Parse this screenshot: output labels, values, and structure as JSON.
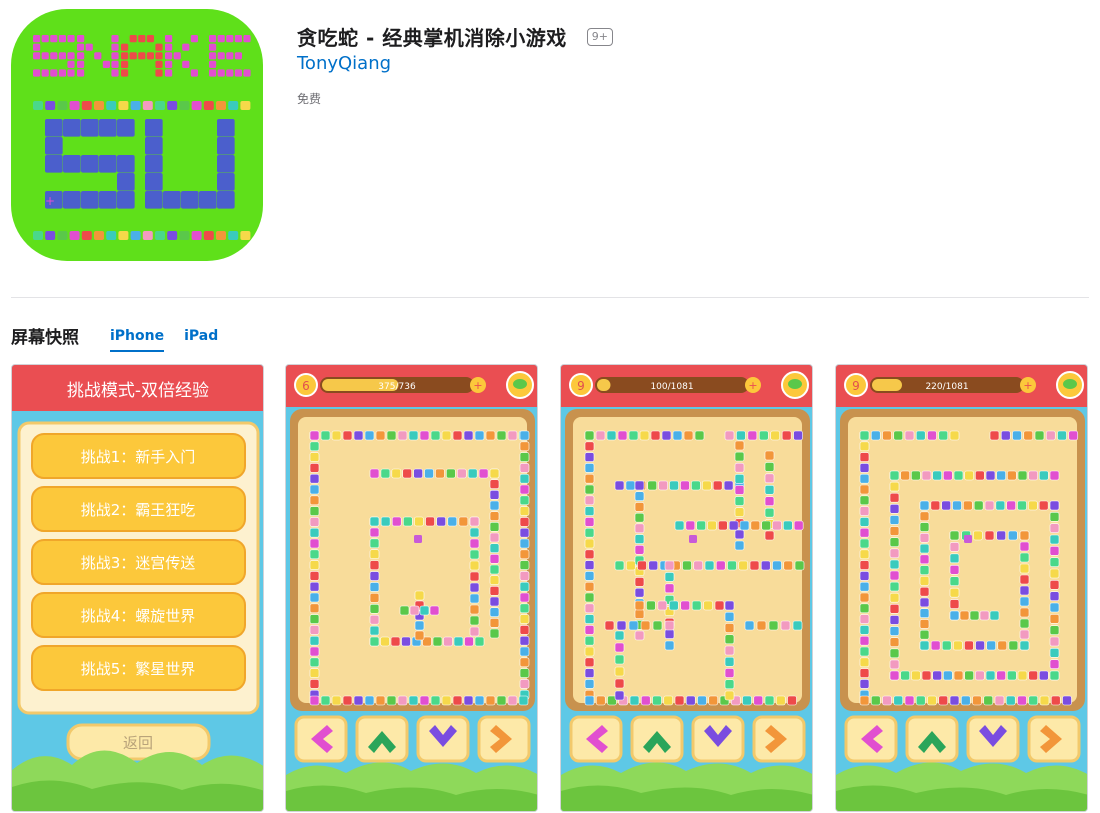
{
  "app": {
    "title": "贪吃蛇 - 经典掌机消除小游戏",
    "age_rating": "9+",
    "developer": "TonyQiang",
    "price": "免费",
    "icon": {
      "top_word": "SNAKE",
      "bottom_word": "SU",
      "background_color": "#5fe01a"
    }
  },
  "screenshots": {
    "section_title": "屏幕快照",
    "tabs": [
      {
        "label": "iPhone",
        "active": true
      },
      {
        "label": "iPad",
        "active": false
      }
    ],
    "menu_screen": {
      "header": "挑战模式-双倍经验",
      "items": [
        "挑战1：新手入门",
        "挑战2：霸王狂吃",
        "挑战3：迷宫传送",
        "挑战4：螺旋世界",
        "挑战5：繁星世界"
      ],
      "back_label": "返回"
    },
    "game_screens": [
      {
        "level": "6",
        "progress_text": "375/736",
        "progress": 0.51
      },
      {
        "level": "9",
        "progress_text": "100/1081",
        "progress": 0.09
      },
      {
        "level": "9",
        "progress_text": "220/1081",
        "progress": 0.2
      }
    ],
    "controls": [
      "left-arrow-icon",
      "up-arrow-icon",
      "down-arrow-icon",
      "right-arrow-icon"
    ]
  }
}
